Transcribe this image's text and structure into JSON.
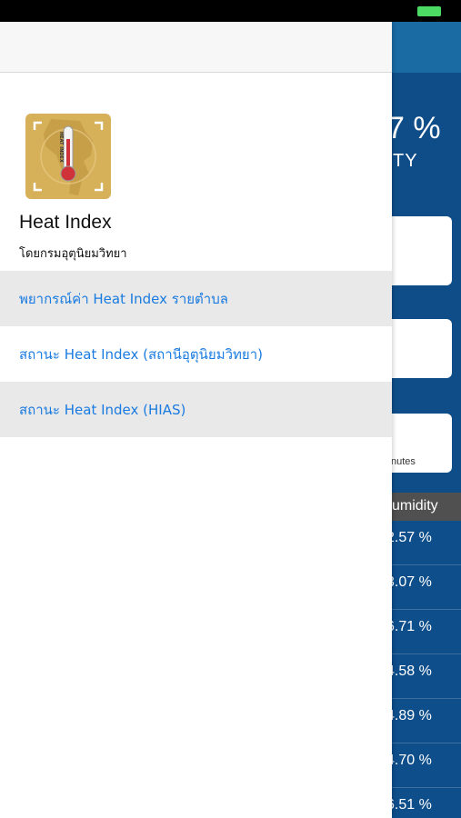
{
  "background": {
    "percent": "7 %",
    "percent_label": "TY",
    "card3_text": "nutes",
    "col_header": "umidity",
    "rows": [
      "2.57 %",
      "3.07 %",
      "6.71 %",
      "4.58 %",
      "4.89 %",
      "4.70 %",
      "6.51 %"
    ]
  },
  "drawer": {
    "app_name": "Heat Index",
    "publisher": "โดยกรมอุตุนิยมวิทยา",
    "menu": [
      {
        "label": "พยากรณ์ค่า Heat Index รายตำบล"
      },
      {
        "label": "สถานะ Heat Index (สถานีอุตุนิยมวิทยา)"
      },
      {
        "label": "สถานะ Heat Index (HIAS)"
      }
    ]
  },
  "icon_text": "HEAT INDEX",
  "colors": {
    "accent": "#1a7be0",
    "bg_blue": "#0e4e8b",
    "battery": "#4cd964",
    "icon_gold": "#d7b15a"
  }
}
